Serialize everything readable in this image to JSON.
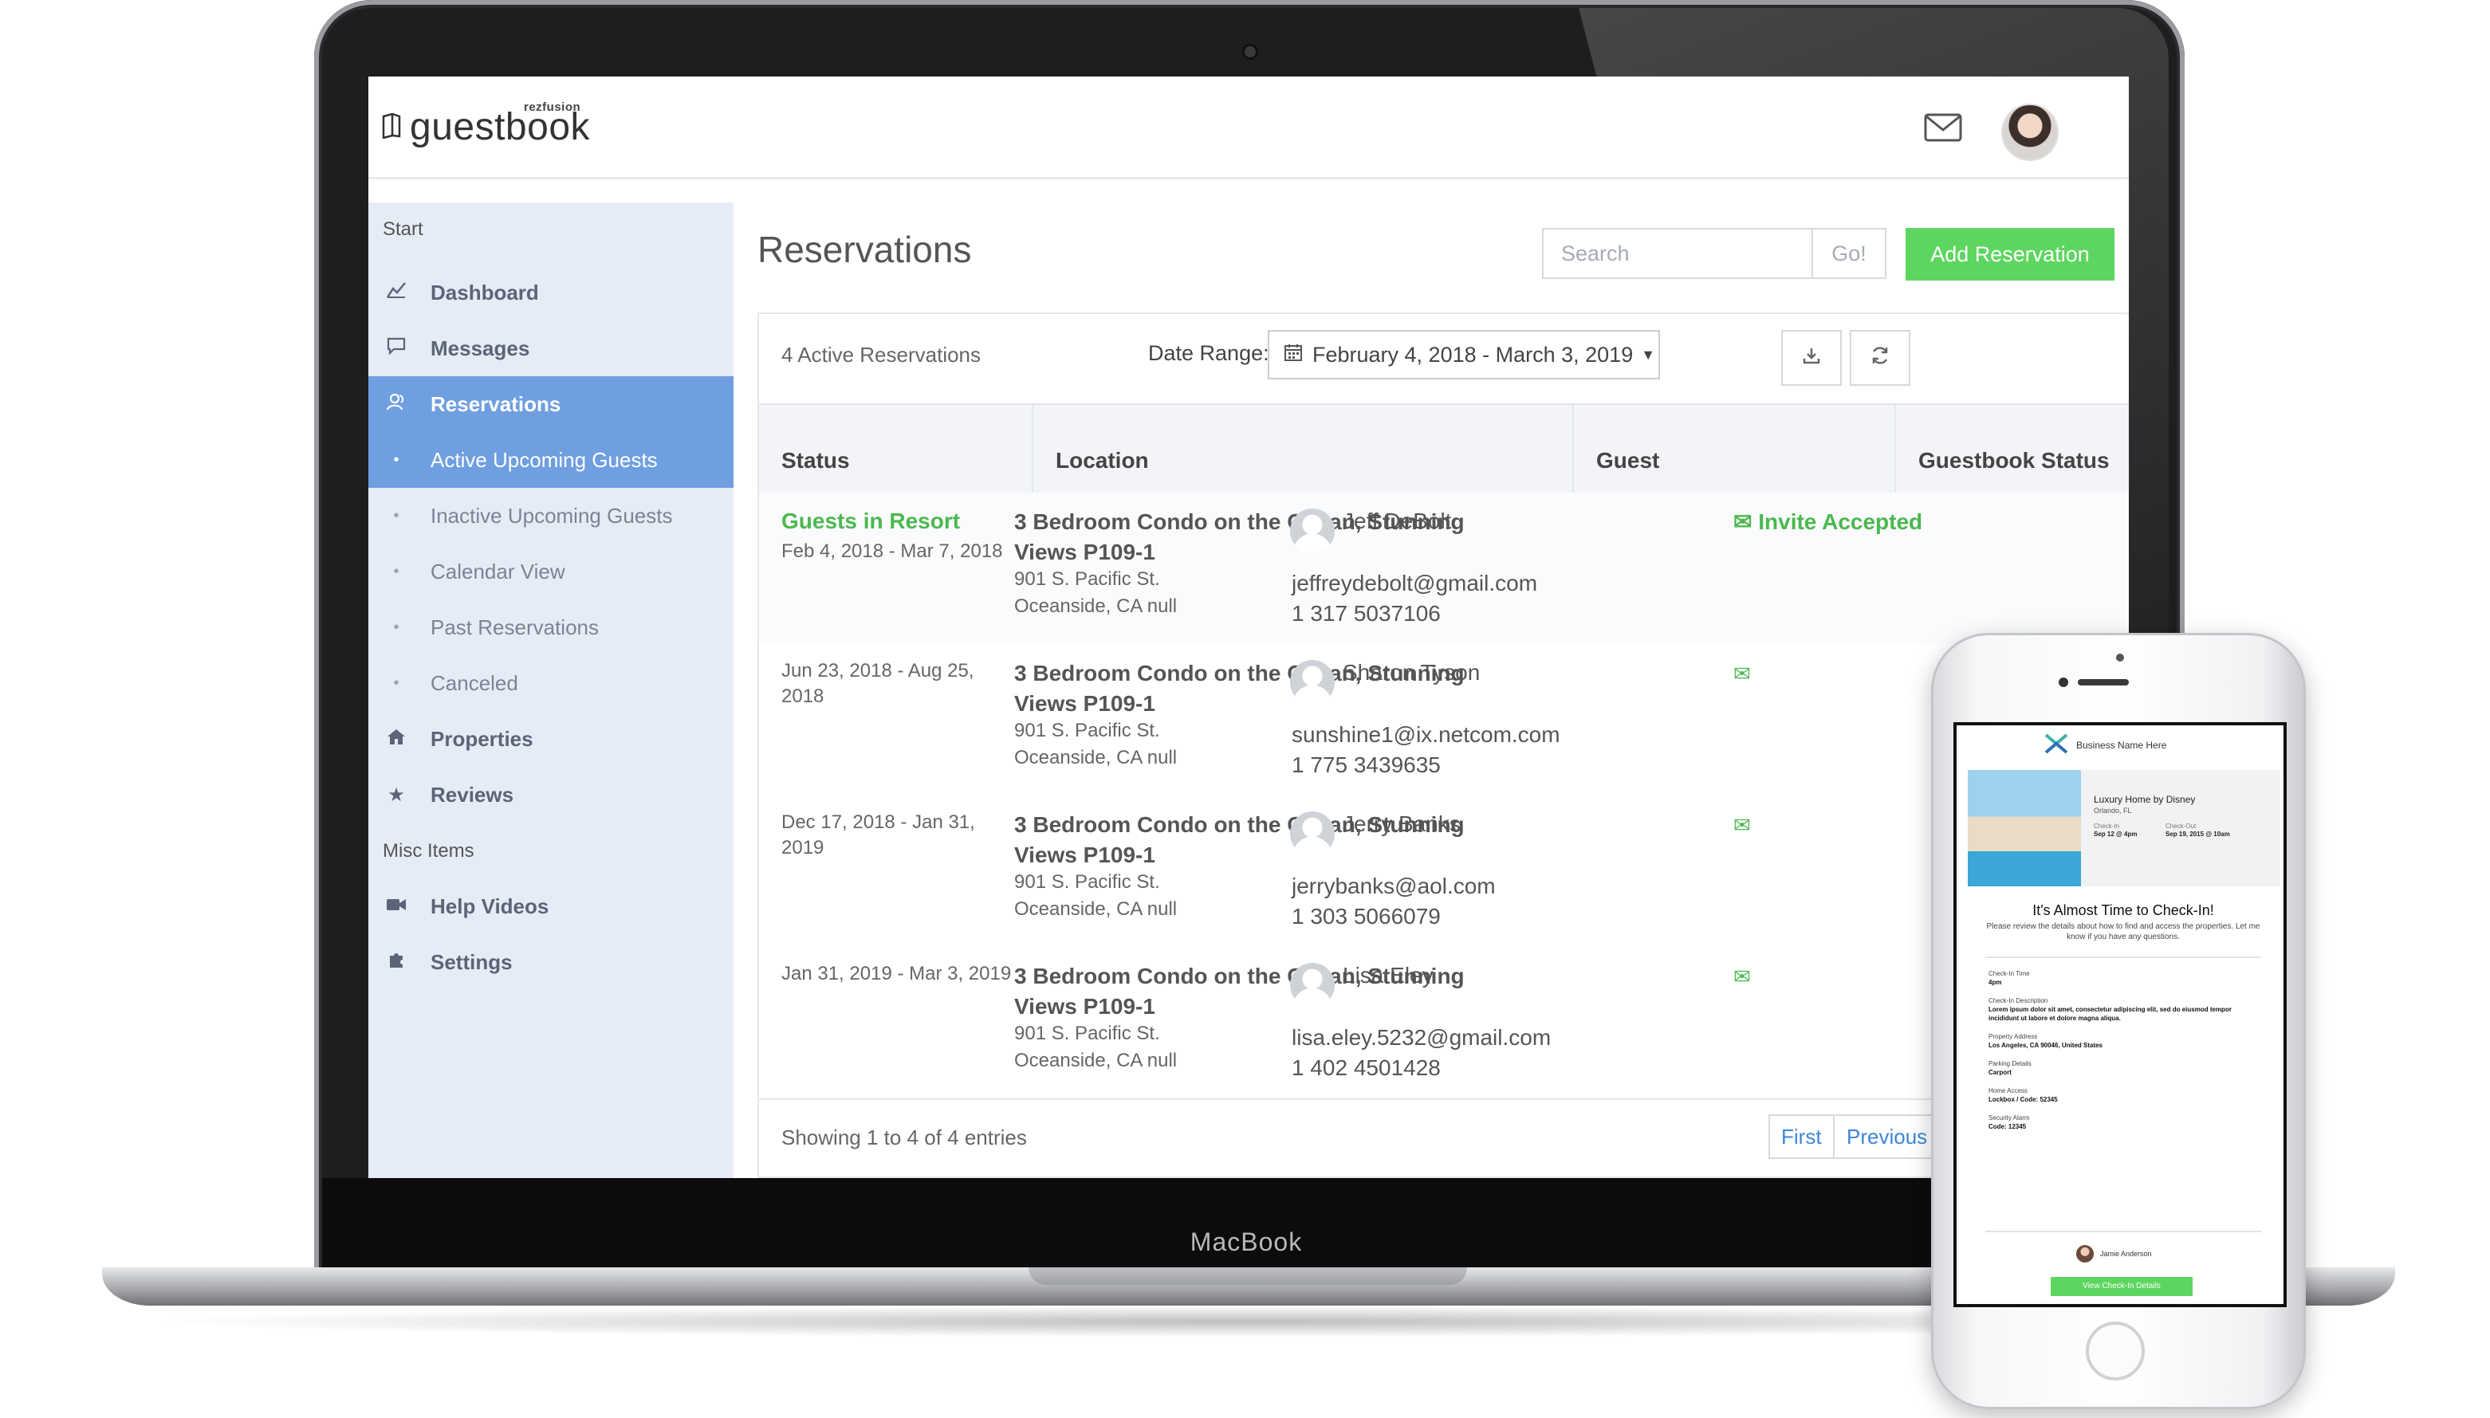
{
  "device": {
    "brand_label": "MacBook"
  },
  "app": {
    "logo_small": "rezfusion",
    "logo_text": "guestbook",
    "mail_icon": "envelope-icon",
    "avatar_icon": "user-avatar"
  },
  "sidebar": {
    "start_label": "Start",
    "misc_label": "Misc Items",
    "items": [
      {
        "label": "Dashboard",
        "icon": "chart-line-icon"
      },
      {
        "label": "Messages",
        "icon": "chat-bubble-icon"
      },
      {
        "label": "Reservations",
        "icon": "users-icon",
        "active": true
      },
      {
        "label": "Active Upcoming Guests",
        "icon": "bullet-icon",
        "active": true
      },
      {
        "label": "Inactive Upcoming Guests",
        "icon": "bullet-icon"
      },
      {
        "label": "Calendar View",
        "icon": "bullet-icon"
      },
      {
        "label": "Past Reservations",
        "icon": "bullet-icon"
      },
      {
        "label": "Canceled",
        "icon": "bullet-icon"
      },
      {
        "label": "Properties",
        "icon": "home-icon"
      },
      {
        "label": "Reviews",
        "icon": "star-icon"
      },
      {
        "label": "Help Videos",
        "icon": "video-camera-icon"
      },
      {
        "label": "Settings",
        "icon": "puzzle-icon"
      }
    ]
  },
  "main": {
    "title": "Reservations",
    "search_placeholder": "Search",
    "go_label": "Go!",
    "add_label": "Add Reservation",
    "active_count": "4 Active Reservations",
    "date_range_label": "Date Range:",
    "date_range_value": "February 4, 2018 - March 3, 2019",
    "columns": [
      "Status",
      "Location",
      "Guest",
      "Guestbook Status"
    ],
    "rows": [
      {
        "status": "Guests in Resort",
        "dates": "Feb 4, 2018 - Mar 7, 2018",
        "property": "3 Bedroom Condo on the Ocean, Stunning Views P109-1",
        "street": "901 S. Pacific St.",
        "city": "Oceanside, CA null",
        "guest_name": "Jeff DeBolt",
        "guest_email": "jeffreydebolt@gmail.com",
        "guest_phone": "1 317 5037106",
        "guestbook_status": "Invite Accepted"
      },
      {
        "status": "",
        "dates": "Jun 23, 2018 - Aug 25, 2018",
        "property": "3 Bedroom Condo on the Ocean, Stunning Views P109-1",
        "street": "901 S. Pacific St.",
        "city": "Oceanside, CA null",
        "guest_name": "Sharon Tyson",
        "guest_email": "sunshine1@ix.netcom.com",
        "guest_phone": "1 775 3439635",
        "guestbook_status": ""
      },
      {
        "status": "",
        "dates": "Dec 17, 2018 - Jan 31, 2019",
        "property": "3 Bedroom Condo on the Ocean, Stunning Views P109-1",
        "street": "901 S. Pacific St.",
        "city": "Oceanside, CA null",
        "guest_name": "Jerry Banks",
        "guest_email": "jerrybanks@aol.com",
        "guest_phone": "1 303 5066079",
        "guestbook_status": ""
      },
      {
        "status": "",
        "dates": "Jan 31, 2019 - Mar 3, 2019",
        "property": "3 Bedroom Condo on the Ocean, Stunning Views P109-1",
        "street": "901 S. Pacific St.",
        "city": "Oceanside, CA null",
        "guest_name": "Lisa Eley",
        "guest_email": "lisa.eley.5232@gmail.com",
        "guest_phone": "1 402 4501428",
        "guestbook_status": ""
      }
    ],
    "footer_text": "Showing 1 to 4 of 4 entries",
    "pager": {
      "first": "First",
      "previous": "Previous"
    }
  },
  "phone_email": {
    "business_name": "Business Name Here",
    "property_name": "Luxury Home by Disney",
    "property_location": "Orlando, FL",
    "checkin_label": "Check-In",
    "checkin_value": "Sep 12 @ 4pm",
    "checkout_label": "Check-Out",
    "checkout_value": "Sep 19, 2015 @ 10am",
    "headline": "It's Almost Time to Check-In!",
    "intro": "Please review the details about how to find and access the properties. Let me know if you have any questions.",
    "sections": [
      {
        "label": "Check-In Time",
        "value": "4pm"
      },
      {
        "label": "Check-In Description",
        "value": "Lorem ipsum dolor sit amet, consectetur adipiscing elit, sed do eiusmod tempor incididunt ut labore et dolore magna aliqua."
      },
      {
        "label": "Property Address",
        "value": "Los Angeles, CA 90046, United States"
      },
      {
        "label": "Parking Details",
        "value": "Carport"
      },
      {
        "label": "Home Access",
        "value": "Lockbox / Code: 52345"
      },
      {
        "label": "Security Alarm",
        "value": "Code: 12345"
      }
    ],
    "host_name": "Jamie Anderson",
    "cta_label": "View Check-In Details"
  },
  "colors": {
    "accent_green": "#5dd65f",
    "sidebar_active": "#6f9fe0",
    "sidebar_bg": "#e6ecf6",
    "link_blue": "#3d86d8"
  }
}
